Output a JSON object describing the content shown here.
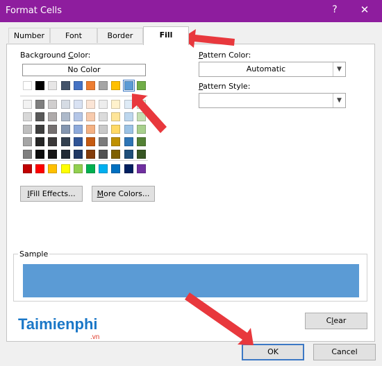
{
  "window": {
    "title": "Format Cells",
    "help_glyph": "?",
    "close_glyph": "✕",
    "titlebar_color": "#8e1d9e"
  },
  "tabs": [
    {
      "label": "Number",
      "active": false
    },
    {
      "label": "Font",
      "active": false
    },
    {
      "label": "Border",
      "active": false
    },
    {
      "label": "Fill",
      "active": true
    }
  ],
  "background_color": {
    "label_prefix": "Background ",
    "label_key": "C",
    "label_suffix": "olor:",
    "no_color_label": "No Color",
    "theme_colors": [
      "#ffffff",
      "#000000",
      "#e7e6e6",
      "#44546a",
      "#4472c4",
      "#ed7d31",
      "#a5a5a5",
      "#ffc000",
      "#5b9bd5",
      "#70ad47"
    ],
    "theme_shades": [
      [
        "#f2f2f2",
        "#7f7f7f",
        "#d0cece",
        "#d6dce4",
        "#d9e2f3",
        "#fbe5d6",
        "#ededed",
        "#fff2cc",
        "#deebf6",
        "#e2efd9"
      ],
      [
        "#d8d8d8",
        "#595959",
        "#aeaaaa",
        "#adb9ca",
        "#b4c6e7",
        "#f8cbad",
        "#dbdbdb",
        "#fee599",
        "#bdd7ee",
        "#c5e0b3"
      ],
      [
        "#bfbfbf",
        "#3f3f3f",
        "#757070",
        "#8496b0",
        "#8eaadb",
        "#f4b183",
        "#c9c9c9",
        "#ffd965",
        "#9cc3e5",
        "#a8d08d"
      ],
      [
        "#a5a5a5",
        "#262626",
        "#3a3838",
        "#323f4f",
        "#2f5496",
        "#c55a11",
        "#7b7b7b",
        "#bf9000",
        "#2e75b5",
        "#538135"
      ],
      [
        "#7f7f7f",
        "#0c0c0c",
        "#171616",
        "#222a35",
        "#1f3864",
        "#833c0b",
        "#525252",
        "#7f6000",
        "#1e4e79",
        "#375623"
      ]
    ],
    "standard_colors": [
      "#c00000",
      "#ff0000",
      "#ffc000",
      "#ffff00",
      "#92d050",
      "#00b050",
      "#00b0f0",
      "#0070c0",
      "#002060",
      "#7030a0"
    ],
    "selected_color": "#5b9bd5"
  },
  "buttons": {
    "fill_effects": {
      "key": "I",
      "rest": "Fill Effects..."
    },
    "more_colors": {
      "key": "M",
      "rest": "ore Colors..."
    },
    "clear": {
      "key": "",
      "prefix": "C",
      "underlined": "l",
      "rest": "ear"
    },
    "ok": "OK",
    "cancel": "Cancel"
  },
  "pattern": {
    "color_label_key": "P",
    "color_label_rest": "attern Color:",
    "color_value": "Automatic",
    "style_label_key": "P",
    "style_label_rest": "attern Style:",
    "style_value": ""
  },
  "sample": {
    "label": "Sample",
    "fill_color": "#5b9bd5"
  },
  "watermark": {
    "text": "Taimienphi",
    "suffix": ".vn"
  },
  "annotation_color": "#e8383d"
}
